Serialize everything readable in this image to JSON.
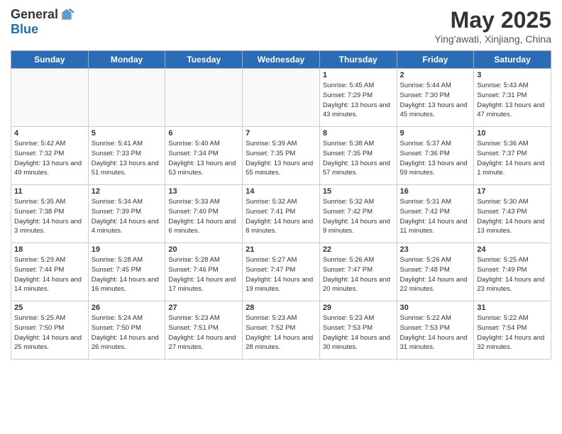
{
  "header": {
    "logo_general": "General",
    "logo_blue": "Blue",
    "month": "May 2025",
    "location": "Ying'awati, Xinjiang, China"
  },
  "weekdays": [
    "Sunday",
    "Monday",
    "Tuesday",
    "Wednesday",
    "Thursday",
    "Friday",
    "Saturday"
  ],
  "weeks": [
    [
      {
        "day": "",
        "empty": true
      },
      {
        "day": "",
        "empty": true
      },
      {
        "day": "",
        "empty": true
      },
      {
        "day": "",
        "empty": true
      },
      {
        "day": "1",
        "sunrise": "5:45 AM",
        "sunset": "7:29 PM",
        "daylight": "13 hours and 43 minutes."
      },
      {
        "day": "2",
        "sunrise": "5:44 AM",
        "sunset": "7:30 PM",
        "daylight": "13 hours and 45 minutes."
      },
      {
        "day": "3",
        "sunrise": "5:43 AM",
        "sunset": "7:31 PM",
        "daylight": "13 hours and 47 minutes."
      }
    ],
    [
      {
        "day": "4",
        "sunrise": "5:42 AM",
        "sunset": "7:32 PM",
        "daylight": "13 hours and 49 minutes."
      },
      {
        "day": "5",
        "sunrise": "5:41 AM",
        "sunset": "7:33 PM",
        "daylight": "13 hours and 51 minutes."
      },
      {
        "day": "6",
        "sunrise": "5:40 AM",
        "sunset": "7:34 PM",
        "daylight": "13 hours and 53 minutes."
      },
      {
        "day": "7",
        "sunrise": "5:39 AM",
        "sunset": "7:35 PM",
        "daylight": "13 hours and 55 minutes."
      },
      {
        "day": "8",
        "sunrise": "5:38 AM",
        "sunset": "7:35 PM",
        "daylight": "13 hours and 57 minutes."
      },
      {
        "day": "9",
        "sunrise": "5:37 AM",
        "sunset": "7:36 PM",
        "daylight": "13 hours and 59 minutes."
      },
      {
        "day": "10",
        "sunrise": "5:36 AM",
        "sunset": "7:37 PM",
        "daylight": "14 hours and 1 minute."
      }
    ],
    [
      {
        "day": "11",
        "sunrise": "5:35 AM",
        "sunset": "7:38 PM",
        "daylight": "14 hours and 3 minutes."
      },
      {
        "day": "12",
        "sunrise": "5:34 AM",
        "sunset": "7:39 PM",
        "daylight": "14 hours and 4 minutes."
      },
      {
        "day": "13",
        "sunrise": "5:33 AM",
        "sunset": "7:40 PM",
        "daylight": "14 hours and 6 minutes."
      },
      {
        "day": "14",
        "sunrise": "5:32 AM",
        "sunset": "7:41 PM",
        "daylight": "14 hours and 8 minutes."
      },
      {
        "day": "15",
        "sunrise": "5:32 AM",
        "sunset": "7:42 PM",
        "daylight": "14 hours and 9 minutes."
      },
      {
        "day": "16",
        "sunrise": "5:31 AM",
        "sunset": "7:42 PM",
        "daylight": "14 hours and 11 minutes."
      },
      {
        "day": "17",
        "sunrise": "5:30 AM",
        "sunset": "7:43 PM",
        "daylight": "14 hours and 13 minutes."
      }
    ],
    [
      {
        "day": "18",
        "sunrise": "5:29 AM",
        "sunset": "7:44 PM",
        "daylight": "14 hours and 14 minutes."
      },
      {
        "day": "19",
        "sunrise": "5:28 AM",
        "sunset": "7:45 PM",
        "daylight": "14 hours and 16 minutes."
      },
      {
        "day": "20",
        "sunrise": "5:28 AM",
        "sunset": "7:46 PM",
        "daylight": "14 hours and 17 minutes."
      },
      {
        "day": "21",
        "sunrise": "5:27 AM",
        "sunset": "7:47 PM",
        "daylight": "14 hours and 19 minutes."
      },
      {
        "day": "22",
        "sunrise": "5:26 AM",
        "sunset": "7:47 PM",
        "daylight": "14 hours and 20 minutes."
      },
      {
        "day": "23",
        "sunrise": "5:26 AM",
        "sunset": "7:48 PM",
        "daylight": "14 hours and 22 minutes."
      },
      {
        "day": "24",
        "sunrise": "5:25 AM",
        "sunset": "7:49 PM",
        "daylight": "14 hours and 23 minutes."
      }
    ],
    [
      {
        "day": "25",
        "sunrise": "5:25 AM",
        "sunset": "7:50 PM",
        "daylight": "14 hours and 25 minutes."
      },
      {
        "day": "26",
        "sunrise": "5:24 AM",
        "sunset": "7:50 PM",
        "daylight": "14 hours and 26 minutes."
      },
      {
        "day": "27",
        "sunrise": "5:23 AM",
        "sunset": "7:51 PM",
        "daylight": "14 hours and 27 minutes."
      },
      {
        "day": "28",
        "sunrise": "5:23 AM",
        "sunset": "7:52 PM",
        "daylight": "14 hours and 28 minutes."
      },
      {
        "day": "29",
        "sunrise": "5:23 AM",
        "sunset": "7:53 PM",
        "daylight": "14 hours and 30 minutes."
      },
      {
        "day": "30",
        "sunrise": "5:22 AM",
        "sunset": "7:53 PM",
        "daylight": "14 hours and 31 minutes."
      },
      {
        "day": "31",
        "sunrise": "5:22 AM",
        "sunset": "7:54 PM",
        "daylight": "14 hours and 32 minutes."
      }
    ]
  ]
}
